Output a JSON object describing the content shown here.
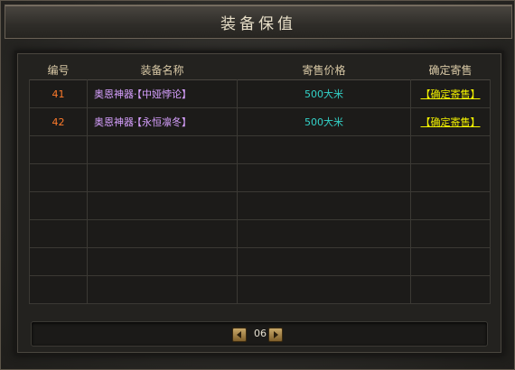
{
  "window": {
    "title": "装备保值"
  },
  "table": {
    "headers": [
      "编号",
      "装备名称",
      "寄售价格",
      "确定寄售"
    ],
    "rows": [
      {
        "num": "41",
        "name": "奥恩神器·【中娅悖论】",
        "price": "500大米",
        "action": "【确定寄售】"
      },
      {
        "num": "42",
        "name": "奥恩神器·【永恒凛冬】",
        "price": "500大米",
        "action": "【确定寄售】"
      },
      {
        "num": "",
        "name": "",
        "price": "",
        "action": ""
      },
      {
        "num": "",
        "name": "",
        "price": "",
        "action": ""
      },
      {
        "num": "",
        "name": "",
        "price": "",
        "action": ""
      },
      {
        "num": "",
        "name": "",
        "price": "",
        "action": ""
      },
      {
        "num": "",
        "name": "",
        "price": "",
        "action": ""
      },
      {
        "num": "",
        "name": "",
        "price": "",
        "action": ""
      }
    ]
  },
  "pager": {
    "page": "06"
  }
}
